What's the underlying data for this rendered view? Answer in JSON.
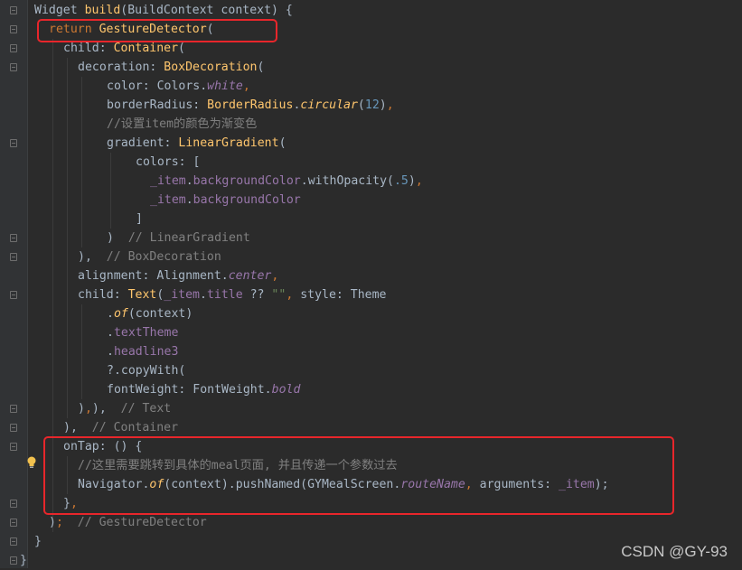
{
  "editor": {
    "lines": [
      {
        "indent": 38,
        "tokens": [
          [
            "plain",
            "Widget "
          ],
          [
            "cls",
            "build"
          ],
          [
            "plain",
            "(BuildContext context) {"
          ]
        ]
      },
      {
        "indent": 54,
        "tokens": [
          [
            "kw",
            "return "
          ],
          [
            "cls",
            "GestureDetector"
          ],
          [
            "plain",
            "("
          ]
        ]
      },
      {
        "indent": 70,
        "tokens": [
          [
            "plain",
            "child: "
          ],
          [
            "cls",
            "Container"
          ],
          [
            "plain",
            "("
          ]
        ]
      },
      {
        "indent": 86,
        "tokens": [
          [
            "plain",
            "decoration: "
          ],
          [
            "cls",
            "BoxDecoration"
          ],
          [
            "plain",
            "("
          ]
        ]
      },
      {
        "indent": 118,
        "tokens": [
          [
            "plain",
            "color: Colors."
          ],
          [
            "ital",
            "white"
          ],
          [
            "kw",
            ","
          ]
        ]
      },
      {
        "indent": 118,
        "tokens": [
          [
            "plain",
            "borderRadius: "
          ],
          [
            "cls",
            "BorderRadius"
          ],
          [
            "plain",
            "."
          ],
          [
            "fn-ital",
            "circular"
          ],
          [
            "plain",
            "("
          ],
          [
            "num",
            "12"
          ],
          [
            "plain",
            ")"
          ],
          [
            "kw",
            ","
          ]
        ]
      },
      {
        "indent": 118,
        "tokens": [
          [
            "cmt",
            "//设置item的颜色为渐变色"
          ]
        ]
      },
      {
        "indent": 118,
        "tokens": [
          [
            "plain",
            "gradient: "
          ],
          [
            "cls",
            "LinearGradient"
          ],
          [
            "plain",
            "("
          ]
        ]
      },
      {
        "indent": 150,
        "tokens": [
          [
            "plain",
            "colors: ["
          ]
        ]
      },
      {
        "indent": 166,
        "tokens": [
          [
            "prop",
            "_item"
          ],
          [
            "plain",
            "."
          ],
          [
            "prop",
            "backgroundColor"
          ],
          [
            "plain",
            ".withOpacity("
          ],
          [
            "num",
            ".5"
          ],
          [
            "plain",
            ")"
          ],
          [
            "kw",
            ","
          ]
        ]
      },
      {
        "indent": 166,
        "tokens": [
          [
            "prop",
            "_item"
          ],
          [
            "plain",
            "."
          ],
          [
            "prop",
            "backgroundColor"
          ]
        ]
      },
      {
        "indent": 150,
        "tokens": [
          [
            "plain",
            "]"
          ]
        ]
      },
      {
        "indent": 118,
        "tokens": [
          [
            "plain",
            ")  "
          ],
          [
            "cmt",
            "// LinearGradient"
          ]
        ]
      },
      {
        "indent": 86,
        "tokens": [
          [
            "plain",
            "),  "
          ],
          [
            "cmt",
            "// BoxDecoration"
          ]
        ]
      },
      {
        "indent": 86,
        "tokens": [
          [
            "plain",
            "alignment: Alignment."
          ],
          [
            "ital",
            "center"
          ],
          [
            "kw",
            ","
          ]
        ]
      },
      {
        "indent": 86,
        "tokens": [
          [
            "plain",
            "child: "
          ],
          [
            "cls",
            "Text"
          ],
          [
            "plain",
            "("
          ],
          [
            "prop",
            "_item"
          ],
          [
            "plain",
            "."
          ],
          [
            "prop",
            "title"
          ],
          [
            "plain",
            " ?? "
          ],
          [
            "str",
            "\"\""
          ],
          [
            "kw",
            ", "
          ],
          [
            "plain",
            "style: Theme"
          ]
        ]
      },
      {
        "indent": 118,
        "tokens": [
          [
            "plain",
            "."
          ],
          [
            "fn-ital",
            "of"
          ],
          [
            "plain",
            "(context)"
          ]
        ]
      },
      {
        "indent": 118,
        "tokens": [
          [
            "plain",
            "."
          ],
          [
            "prop",
            "textTheme"
          ]
        ]
      },
      {
        "indent": 118,
        "tokens": [
          [
            "plain",
            "."
          ],
          [
            "prop",
            "headline3"
          ]
        ]
      },
      {
        "indent": 118,
        "tokens": [
          [
            "plain",
            "?.copyWith("
          ]
        ]
      },
      {
        "indent": 118,
        "tokens": [
          [
            "plain",
            "fontWeight: FontWeight."
          ],
          [
            "ital",
            "bold"
          ]
        ]
      },
      {
        "indent": 86,
        "tokens": [
          [
            "plain",
            ")"
          ],
          [
            "kw",
            ","
          ],
          [
            "plain",
            "),  "
          ],
          [
            "cmt",
            "// Text"
          ]
        ]
      },
      {
        "indent": 70,
        "tokens": [
          [
            "plain",
            "),  "
          ],
          [
            "cmt",
            "// Container"
          ]
        ]
      },
      {
        "indent": 70,
        "tokens": [
          [
            "plain",
            "onTap: () {"
          ]
        ]
      },
      {
        "indent": 86,
        "tokens": [
          [
            "cmt",
            "//这里需要跳转到具体的meal页面, 并且传递一个参数过去"
          ]
        ]
      },
      {
        "indent": 86,
        "tokens": [
          [
            "plain",
            "Navigator."
          ],
          [
            "fn-ital",
            "of"
          ],
          [
            "plain",
            "(context).pushNamed(GYMealScreen."
          ],
          [
            "ital",
            "routeName"
          ],
          [
            "kw",
            ", "
          ],
          [
            "plain",
            "arguments: "
          ],
          [
            "prop",
            "_item"
          ],
          [
            "plain",
            ");"
          ]
        ]
      },
      {
        "indent": 70,
        "tokens": [
          [
            "plain",
            "}"
          ],
          [
            "kw",
            ","
          ]
        ]
      },
      {
        "indent": 54,
        "tokens": [
          [
            "plain",
            ")"
          ],
          [
            "kw",
            ";"
          ],
          [
            "plain",
            "  "
          ],
          [
            "cmt",
            "// GestureDetector"
          ]
        ]
      },
      {
        "indent": 38,
        "tokens": [
          [
            "plain",
            "}"
          ]
        ]
      },
      {
        "indent": 22,
        "tokens": [
          [
            "plain",
            "}"
          ]
        ]
      }
    ]
  },
  "watermark": "CSDN @GY-93",
  "colors": {
    "background": "#2b2b2b",
    "highlight_box": "#e8262b",
    "keyword": "#cc7832",
    "class_name": "#ffc66d",
    "field": "#9876aa",
    "number": "#6897bb",
    "comment": "#808080",
    "string": "#6a8759",
    "default_text": "#a9b7c6"
  }
}
